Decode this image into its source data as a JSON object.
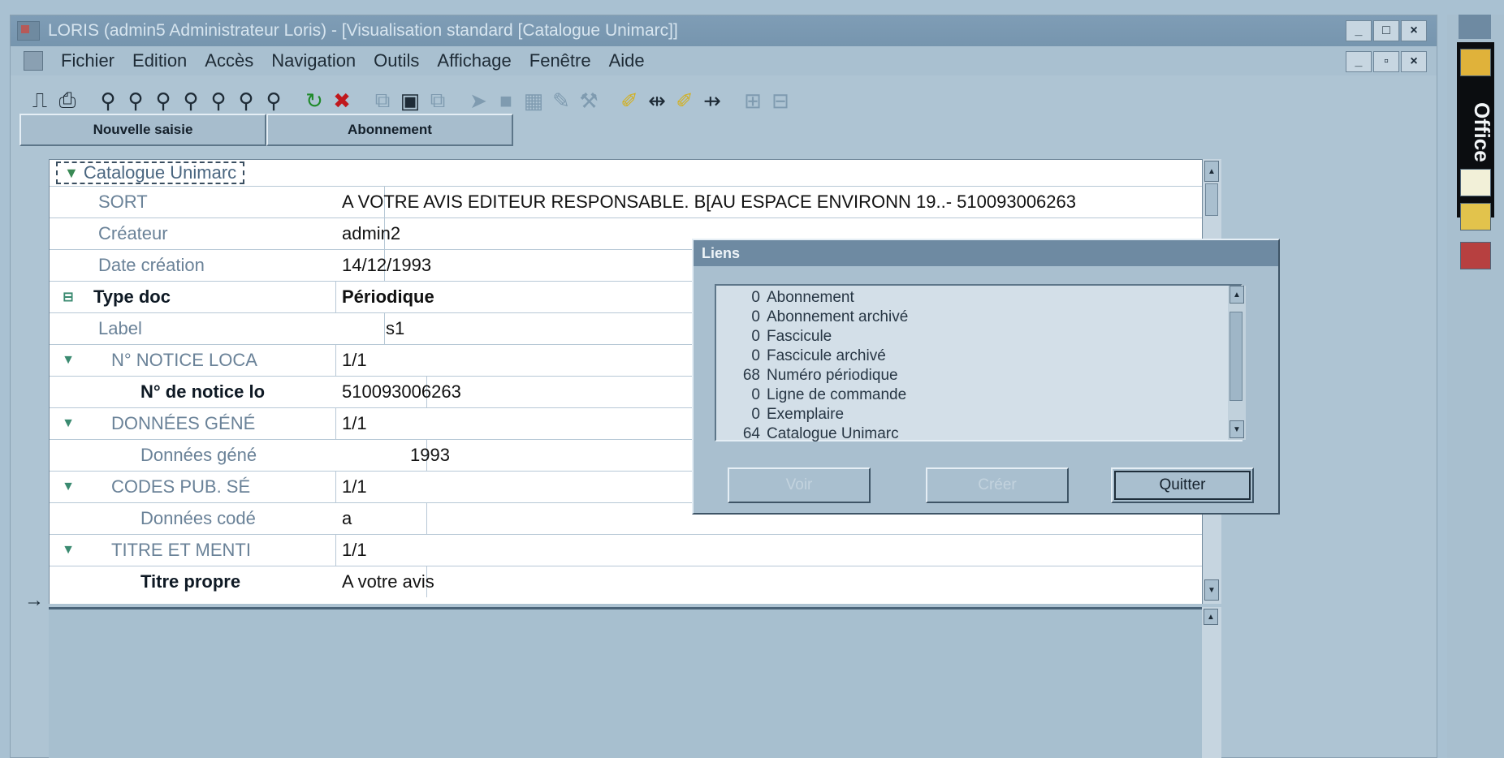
{
  "window": {
    "title": "LORIS (admin5 Administrateur Loris) - [Visualisation standard [Catalogue Unimarc]]",
    "controls": [
      "_",
      "□",
      "×"
    ],
    "doc_controls": [
      "_",
      "▫",
      "×"
    ]
  },
  "menu": [
    "Fichier",
    "Edition",
    "Accès",
    "Navigation",
    "Outils",
    "Affichage",
    "Fenêtre",
    "Aide"
  ],
  "toolbar_icons": [
    "door-icon",
    "print-icon",
    "search-icon",
    "search-icon",
    "search-icon",
    "search-icon",
    "search-icon",
    "search-icon",
    "search-icon",
    "refresh-icon",
    "delete-icon",
    "copy-icon",
    "form-icon",
    "copy-icon",
    "arrow-icon",
    "save-icon",
    "grid-icon",
    "edit-icon",
    "tool-icon",
    "link-icon",
    "link-icon",
    "tree-icon",
    "tree-icon"
  ],
  "tabs": {
    "nouvelle_saisie": "Nouvelle saisie",
    "abonnement": "Abonnement"
  },
  "grid": {
    "header": "Catalogue Unimarc",
    "rows": [
      {
        "label": "SORT",
        "value": "A VOTRE AVIS EDITEUR RESPONSABLE. B[AU ESPACE ENVIRONN 19..- 510093006263"
      },
      {
        "label": "Créateur",
        "value": "admin2"
      },
      {
        "label": "Date création",
        "value": "14/12/1993"
      },
      {
        "label": "Type doc",
        "value": "Périodique"
      },
      {
        "label": "Label",
        "value": "s1"
      },
      {
        "label": "N° NOTICE LOCA",
        "value": "1/1"
      },
      {
        "label": "N° de notice lo",
        "value": "510093006263"
      },
      {
        "label": "DONNÉES GÉNÉ",
        "value": "1/1"
      },
      {
        "label": "Données géné",
        "value": "1993"
      },
      {
        "label": "CODES PUB. SÉ",
        "value": "1/1"
      },
      {
        "label": "Données codé",
        "value": "a"
      },
      {
        "label": "TITRE ET MENTI",
        "value": "1/1"
      },
      {
        "label": "Titre propre",
        "value": "A votre avis"
      }
    ]
  },
  "dialog": {
    "title": "Liens",
    "items": [
      {
        "count": "0",
        "label": "Abonnement"
      },
      {
        "count": "0",
        "label": "Abonnement archivé"
      },
      {
        "count": "0",
        "label": "Fascicule"
      },
      {
        "count": "0",
        "label": "Fascicule archivé"
      },
      {
        "count": "68",
        "label": "Numéro périodique"
      },
      {
        "count": "0",
        "label": "Ligne de commande"
      },
      {
        "count": "0",
        "label": "Exemplaire"
      },
      {
        "count": "64",
        "label": "Catalogue Unimarc"
      }
    ],
    "buttons": {
      "voir": "Voir",
      "creer": "Créer",
      "quitter": "Quitter"
    }
  },
  "office_bar": {
    "label": "Office"
  },
  "colors": {
    "background": "#a9c1d2",
    "title_bar": "#7f9db6",
    "dialog_title": "#6e8aa2",
    "grid_bg": "#ffffff"
  }
}
